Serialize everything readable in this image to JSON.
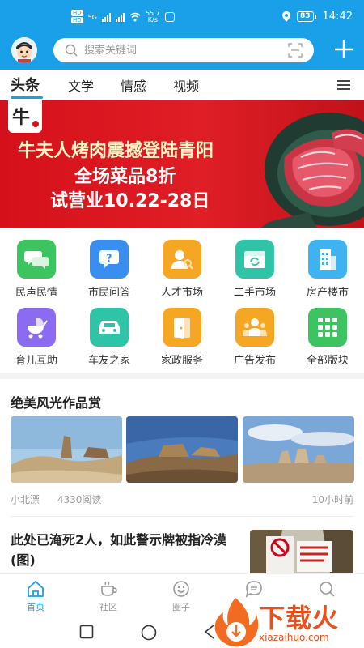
{
  "status_bar": {
    "net_speed_value": "55.7",
    "net_speed_unit": "K/s",
    "battery": "83",
    "time": "14:42",
    "sim1_badge": "HD",
    "sim2_badge": "HD",
    "sim_net": "5G"
  },
  "search": {
    "placeholder": "搜索关键词"
  },
  "tabs": [
    {
      "label": "头条",
      "active": true
    },
    {
      "label": "文学"
    },
    {
      "label": "情感"
    },
    {
      "label": "视频"
    }
  ],
  "banner": {
    "line1": "牛夫人烤肉震撼登陆青阳",
    "line2": "全场菜品8折",
    "line3": "试营业10.22-28日",
    "logo_text": "牛夫人"
  },
  "grid": [
    {
      "label": "民声民情",
      "icon": "chat-bubbles-icon",
      "color": "#3cc461"
    },
    {
      "label": "市民问答",
      "icon": "question-icon",
      "color": "#3a8ef0"
    },
    {
      "label": "人才市场",
      "icon": "person-search-icon",
      "color": "#f5a623"
    },
    {
      "label": "二手市场",
      "icon": "recycle-box-icon",
      "color": "#2fc4a8"
    },
    {
      "label": "房产楼市",
      "icon": "building-icon",
      "color": "#3fb3f0"
    },
    {
      "label": "育儿互助",
      "icon": "baby-stroller-icon",
      "color": "#8b6cf0"
    },
    {
      "label": "车友之家",
      "icon": "car-icon",
      "color": "#2fc4a8"
    },
    {
      "label": "家政服务",
      "icon": "door-icon",
      "color": "#f5a623"
    },
    {
      "label": "广告发布",
      "icon": "group-icon",
      "color": "#f5a623"
    },
    {
      "label": "全部版块",
      "icon": "all-grid-icon",
      "color": "#3cc461"
    }
  ],
  "article1": {
    "title": "绝美风光作品赏",
    "author": "小北漂",
    "reads": "4330阅读",
    "time": "10小时前"
  },
  "article2": {
    "title": "此处已淹死2人，如此警示牌被指冷漠(图)"
  },
  "bottom_nav": [
    {
      "label": "首页",
      "icon": "home-icon",
      "active": true
    },
    {
      "label": "社区",
      "icon": "coffee-cup-icon"
    },
    {
      "label": "圈子",
      "icon": "smile-circle-icon"
    },
    {
      "label": "",
      "icon": "message-icon"
    },
    {
      "label": "",
      "icon": "search-icon"
    }
  ],
  "watermark": {
    "text": "下载火",
    "url_text": "xiazaihuo.com"
  },
  "colors": {
    "brand": "#1aa0e8",
    "banner_red": "#d5101a",
    "watermark": "#e8501c"
  }
}
